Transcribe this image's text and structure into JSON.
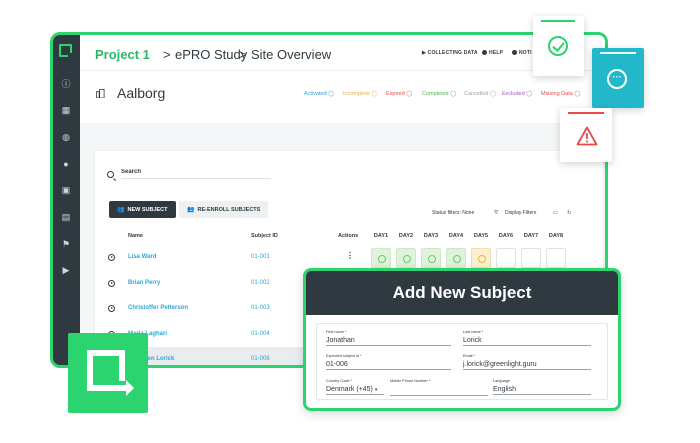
{
  "breadcrumb": {
    "project": "Project 1",
    "study": "ePRO Study",
    "page": "Site Overview",
    "sep": ">"
  },
  "topnav": {
    "collecting": "COLLECTING DATA",
    "help": "HELP",
    "notify": "NOTI"
  },
  "site": {
    "name": "Aalborg"
  },
  "status_legend": [
    {
      "label": "Activated",
      "color": "#2aa8d8"
    },
    {
      "label": "Incomplete",
      "color": "#e6b445"
    },
    {
      "label": "Expired",
      "color": "#e84848"
    },
    {
      "label": "Completed",
      "color": "#4cb84b"
    },
    {
      "label": "Cancelled",
      "color": "#9aa4a8"
    },
    {
      "label": "Excluded",
      "color": "#9b59b6"
    },
    {
      "label": "Missing Data",
      "color": "#e84848"
    }
  ],
  "search": {
    "placeholder": "Search"
  },
  "buttons": {
    "new_subject": "NEW SUBJECT",
    "reenroll": "RE-ENROLL SUBJECTS"
  },
  "filters": {
    "status": "Status filters: None",
    "display": "Display Filters"
  },
  "table": {
    "headers": {
      "name": "Name",
      "id": "Subject ID",
      "actions": "Actions"
    },
    "days": [
      "DAY1",
      "DAY2",
      "DAY3",
      "DAY4",
      "DAY5",
      "DAY6",
      "DAY7",
      "DAY8"
    ],
    "rows": [
      {
        "name": "Lisa Ward",
        "id": "01-001",
        "actions": "⋮"
      },
      {
        "name": "Brian Perry",
        "id": "01-002",
        "actions": "⋮"
      },
      {
        "name": "Christoffer Petterson",
        "id": "01-003",
        "actions": ""
      },
      {
        "name": "Maria Laghari",
        "id": "01-004",
        "actions": ""
      },
      {
        "name": "Jonathen Lorick",
        "id": "01-006",
        "actions": ""
      }
    ]
  },
  "modal": {
    "title": "Add New Subject",
    "first_name_label": "First name *",
    "first_name": "Jonathan",
    "last_name_label": "Last name *",
    "last_name": "Lorick",
    "expected_id_label": "Expected subject id *",
    "expected_id": "01-006",
    "email_label": "Email *",
    "email": "j.lorick@greenlight.guru",
    "country_label": "Country Code *",
    "country": "Denmark (+45)",
    "mobile_label": "Mobile Phone Number *",
    "language_label": "Language",
    "language": "English"
  },
  "colors": {
    "brand": "#2bd46f",
    "sidebar": "#2f3a40",
    "link": "#2aa8d8"
  }
}
